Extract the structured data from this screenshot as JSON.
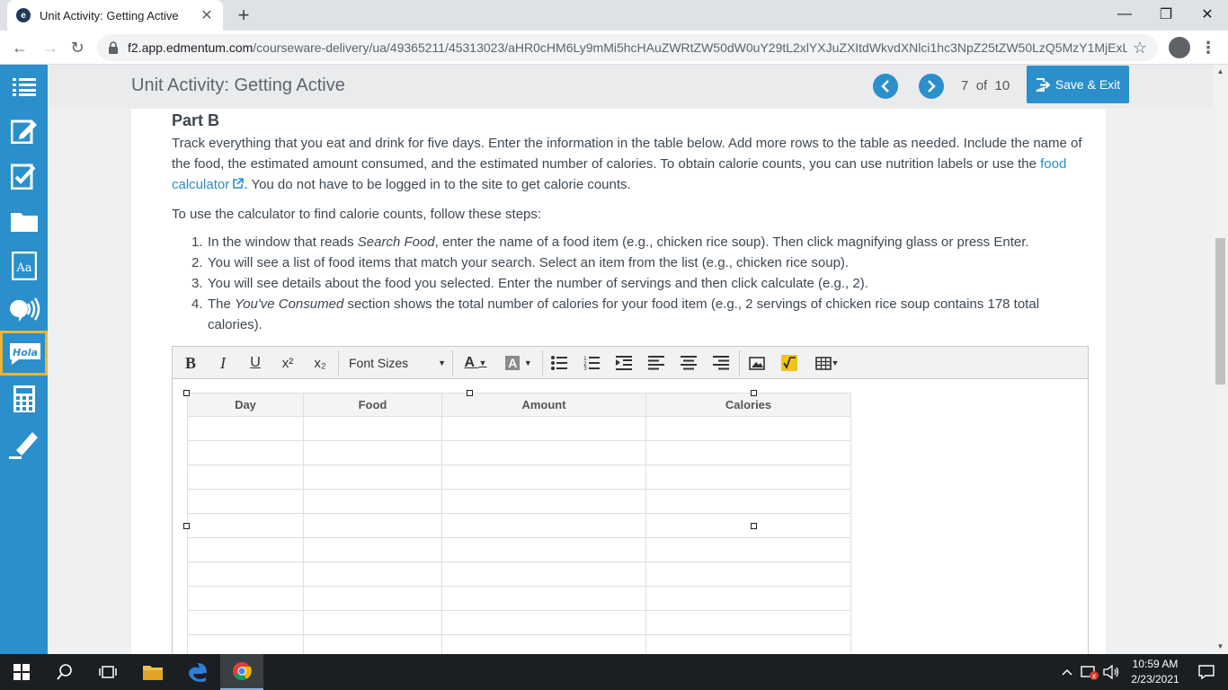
{
  "browser": {
    "tab_title": "Unit Activity: Getting Active",
    "tab_favicon": "e",
    "url_host": "f2.app.edmentum.com",
    "url_path": "/courseware-delivery/ua/49365211/45313023/aHR0cHM6Ly9mMi5hcHAuZWRtZW50dW0uY29tL2xlYXJuZXItdWkvdXNlci1hc3NpZ25tZW50LzQ5MzY1MjExL..."
  },
  "header": {
    "title": "Unit Activity: Getting Active",
    "page_current": "7",
    "page_of": "of",
    "page_total": "10",
    "save_exit": "Save & Exit"
  },
  "content": {
    "part_title": "Part B",
    "intro_before_link": "Track everything that you eat and drink for five days. Enter the information in the table below. Add more rows to the table as needed. Include the name of the food, the estimated amount consumed, and the estimated number of calories. To obtain calorie counts, you can use nutrition labels or use the ",
    "link_text": "food calculator",
    "intro_after_link": ". You do not have to be logged in to the site to get calorie counts.",
    "steps_intro": "To use the calculator to find calorie counts, follow these steps:",
    "steps": [
      {
        "num": "1.",
        "before": "In the window that reads ",
        "em": "Search Food",
        "after": ", enter the name of a food item (e.g., chicken rice soup). Then click magnifying glass or press Enter."
      },
      {
        "num": "2.",
        "before": "You will see a list of food items that match your search. Select an item from the list (e.g., chicken rice soup).",
        "em": "",
        "after": ""
      },
      {
        "num": "3.",
        "before": "You will see details about the food you selected. Enter the number of servings and then click calculate (e.g., 2).",
        "em": "",
        "after": ""
      },
      {
        "num": "4.",
        "before": "The ",
        "em": "You've Consumed",
        "after": " section shows the total number of calories for your food item (e.g., 2 servings of chicken rice soup contains 178 total calories)."
      }
    ]
  },
  "editor": {
    "font_sizes": "Font Sizes",
    "columns": [
      "Day",
      "Food",
      "Amount",
      "Calories"
    ],
    "row_count": 10
  },
  "taskbar": {
    "time": "10:59 AM",
    "date": "2/23/2021"
  },
  "colors": {
    "accent": "#2a8fcb",
    "active_highlight": "#e8b53a"
  }
}
